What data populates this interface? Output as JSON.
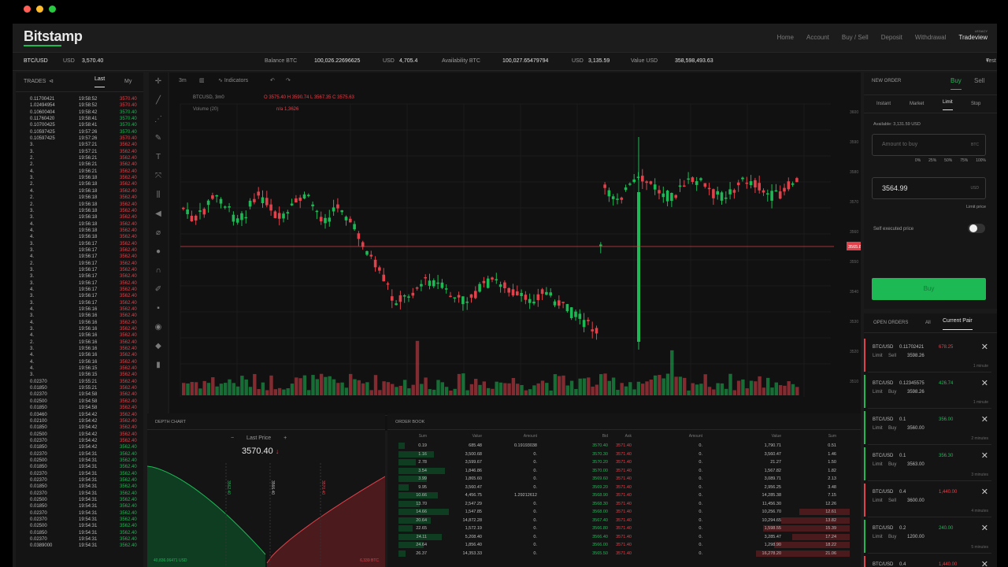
{
  "window": {
    "dot_colors": [
      "#ff5f57",
      "#febc2e",
      "#28c840"
    ]
  },
  "brand": {
    "name": "Bitstamp",
    "accent": "#1db954",
    "sell": "#e0424b"
  },
  "nav": {
    "items": [
      "Home",
      "Account",
      "Buy / Sell",
      "Deposit",
      "Withdrawal"
    ],
    "active": "Tradeview",
    "active_sup": "LEGACY"
  },
  "ticker": {
    "pair": "BTC/USD",
    "usd_label": "USD",
    "price": "3,570.40",
    "balance_label": "Balance BTC",
    "balance_btc": "100,026.22696625",
    "balance_usd_label": "USD",
    "balance_usd": "4,705.4",
    "availability_label": "Availability BTC",
    "availability_btc": "100,027.65479794",
    "avail_usd_label": "USD",
    "avail_usd": "3,135.59",
    "value_label": "Value USD",
    "value_usd": "358,598,493.63",
    "user": "Test User / Main"
  },
  "trades": {
    "title": "TRADES",
    "tabs": [
      "Last",
      "My"
    ],
    "rows": [
      {
        "amount": "0.11700421",
        "time": "19:58:52",
        "price": "3570.40",
        "side": "sell"
      },
      {
        "amount": "1.02494954",
        "time": "19:58:52",
        "price": "3570.40",
        "side": "sell"
      },
      {
        "amount": "0.10600404",
        "time": "19:58:42",
        "price": "3570.40",
        "side": "buy"
      },
      {
        "amount": "0.11760420",
        "time": "19:58:41",
        "price": "3570.40",
        "side": "buy"
      },
      {
        "amount": "0.10700425",
        "time": "19:58:41",
        "price": "3570.40",
        "side": "buy"
      },
      {
        "amount": "0.10597425",
        "time": "19:57:26",
        "price": "3570.40",
        "side": "buy"
      },
      {
        "amount": "0.10597425",
        "time": "19:57:26",
        "price": "3570.40",
        "side": "sell"
      },
      {
        "amount": "3.",
        "time": "19:57:21",
        "price": "3562.40",
        "side": "sell"
      },
      {
        "amount": "3.",
        "time": "19:57:21",
        "price": "3562.40",
        "side": "sell"
      },
      {
        "amount": "2.",
        "time": "19:56:21",
        "price": "3562.40",
        "side": "sell"
      },
      {
        "amount": "2.",
        "time": "19:56:21",
        "price": "3562.40",
        "side": "sell"
      },
      {
        "amount": "4.",
        "time": "19:56:21",
        "price": "3562.40",
        "side": "sell"
      },
      {
        "amount": "3.",
        "time": "19:56:18",
        "price": "3562.40",
        "side": "sell"
      },
      {
        "amount": "2.",
        "time": "19:56:18",
        "price": "3562.40",
        "side": "sell"
      },
      {
        "amount": "4.",
        "time": "19:56:18",
        "price": "3562.40",
        "side": "sell"
      },
      {
        "amount": "2.",
        "time": "19:56:18",
        "price": "3562.40",
        "side": "sell"
      },
      {
        "amount": "2.",
        "time": "19:56:18",
        "price": "3562.40",
        "side": "sell"
      },
      {
        "amount": "3.",
        "time": "19:56:18",
        "price": "3562.40",
        "side": "sell"
      },
      {
        "amount": "3.",
        "time": "19:56:18",
        "price": "3562.40",
        "side": "sell"
      },
      {
        "amount": "4.",
        "time": "19:56:18",
        "price": "3562.40",
        "side": "sell"
      },
      {
        "amount": "4.",
        "time": "19:56:18",
        "price": "3562.40",
        "side": "sell"
      },
      {
        "amount": "4.",
        "time": "19:56:18",
        "price": "3562.40",
        "side": "sell"
      },
      {
        "amount": "3.",
        "time": "19:56:17",
        "price": "3562.40",
        "side": "sell"
      },
      {
        "amount": "3.",
        "time": "19:56:17",
        "price": "3562.40",
        "side": "sell"
      },
      {
        "amount": "4.",
        "time": "19:56:17",
        "price": "3562.40",
        "side": "sell"
      },
      {
        "amount": "2.",
        "time": "19:56:17",
        "price": "3562.40",
        "side": "sell"
      },
      {
        "amount": "3.",
        "time": "19:56:17",
        "price": "3562.40",
        "side": "sell"
      },
      {
        "amount": "3.",
        "time": "19:56:17",
        "price": "3562.40",
        "side": "sell"
      },
      {
        "amount": "3.",
        "time": "19:56:17",
        "price": "3562.40",
        "side": "sell"
      },
      {
        "amount": "4.",
        "time": "19:56:17",
        "price": "3562.40",
        "side": "sell"
      },
      {
        "amount": "3.",
        "time": "19:56:17",
        "price": "3562.40",
        "side": "sell"
      },
      {
        "amount": "3.",
        "time": "19:56:17",
        "price": "3562.40",
        "side": "sell"
      },
      {
        "amount": "4.",
        "time": "19:56:16",
        "price": "3562.40",
        "side": "sell"
      },
      {
        "amount": "3.",
        "time": "19:56:16",
        "price": "3562.40",
        "side": "sell"
      },
      {
        "amount": "4.",
        "time": "19:56:16",
        "price": "3562.40",
        "side": "sell"
      },
      {
        "amount": "3.",
        "time": "19:56:16",
        "price": "3562.40",
        "side": "sell"
      },
      {
        "amount": "4.",
        "time": "19:56:16",
        "price": "3562.40",
        "side": "sell"
      },
      {
        "amount": "2.",
        "time": "19:56:16",
        "price": "3562.40",
        "side": "sell"
      },
      {
        "amount": "3.",
        "time": "19:56:16",
        "price": "3562.40",
        "side": "sell"
      },
      {
        "amount": "4.",
        "time": "19:56:16",
        "price": "3562.40",
        "side": "sell"
      },
      {
        "amount": "4.",
        "time": "19:56:16",
        "price": "3562.40",
        "side": "sell"
      },
      {
        "amount": "4.",
        "time": "19:56:15",
        "price": "3562.40",
        "side": "sell"
      },
      {
        "amount": "3.",
        "time": "19:56:15",
        "price": "3562.40",
        "side": "sell"
      },
      {
        "amount": "0.02370",
        "time": "19:55:21",
        "price": "3562.40",
        "side": "sell"
      },
      {
        "amount": "0.01850",
        "time": "19:55:21",
        "price": "3562.40",
        "side": "sell"
      },
      {
        "amount": "0.02370",
        "time": "19:54:58",
        "price": "3562.40",
        "side": "sell"
      },
      {
        "amount": "0.02500",
        "time": "19:54:58",
        "price": "3562.40",
        "side": "sell"
      },
      {
        "amount": "0.01850",
        "time": "19:54:58",
        "price": "3562.40",
        "side": "sell"
      },
      {
        "amount": "0.03460",
        "time": "19:54:42",
        "price": "3562.40",
        "side": "sell"
      },
      {
        "amount": "0.02100",
        "time": "19:54:42",
        "price": "3562.40",
        "side": "sell"
      },
      {
        "amount": "0.01850",
        "time": "19:54:42",
        "price": "3562.40",
        "side": "sell"
      },
      {
        "amount": "0.02500",
        "time": "19:54:42",
        "price": "3562.40",
        "side": "sell"
      },
      {
        "amount": "0.02370",
        "time": "19:54:42",
        "price": "3562.40",
        "side": "sell"
      },
      {
        "amount": "0.01850",
        "time": "19:54:42",
        "price": "3562.40",
        "side": "buy"
      },
      {
        "amount": "0.02370",
        "time": "19:54:31",
        "price": "3562.40",
        "side": "buy"
      },
      {
        "amount": "0.02500",
        "time": "19:54:31",
        "price": "3562.40",
        "side": "buy"
      },
      {
        "amount": "0.01850",
        "time": "19:54:31",
        "price": "3562.40",
        "side": "buy"
      },
      {
        "amount": "0.02370",
        "time": "19:54:31",
        "price": "3562.40",
        "side": "buy"
      },
      {
        "amount": "0.02370",
        "time": "19:54:31",
        "price": "3562.40",
        "side": "buy"
      },
      {
        "amount": "0.01850",
        "time": "19:54:31",
        "price": "3562.40",
        "side": "buy"
      },
      {
        "amount": "0.02370",
        "time": "19:54:31",
        "price": "3562.40",
        "side": "buy"
      },
      {
        "amount": "0.02500",
        "time": "19:54:31",
        "price": "3562.40",
        "side": "buy"
      },
      {
        "amount": "0.01850",
        "time": "19:54:31",
        "price": "3562.40",
        "side": "buy"
      },
      {
        "amount": "0.02370",
        "time": "19:54:31",
        "price": "3562.40",
        "side": "buy"
      },
      {
        "amount": "0.02370",
        "time": "19:54:31",
        "price": "3562.40",
        "side": "buy"
      },
      {
        "amount": "0.02500",
        "time": "19:54:31",
        "price": "3562.40",
        "side": "buy"
      },
      {
        "amount": "0.01850",
        "time": "19:54:31",
        "price": "3562.40",
        "side": "buy"
      },
      {
        "amount": "0.02370",
        "time": "19:54:31",
        "price": "3562.40",
        "side": "buy"
      },
      {
        "amount": "0.0389000",
        "time": "19:54:31",
        "price": "3562.40",
        "side": "buy"
      }
    ]
  },
  "chart": {
    "toolbar": [
      "3m",
      "Indicators"
    ],
    "symbol_label": "BTCUSD, 3m0",
    "ohlc": "O 3575.40  H 3590.74  L 3567.35  C 3575.63",
    "volume_label": "Volume (20)",
    "volume_value": "n/a  1,3626",
    "current_price": "3565.84",
    "bottom_left": [
      "1D",
      "5D",
      "1M",
      "3M",
      "6M",
      "YTD",
      "1Y",
      "5Y",
      "Goto..."
    ],
    "bottom_right": [
      "14:49:22 (UTC)",
      "%",
      "log",
      "auto"
    ],
    "y_ticks": [
      3600,
      3590,
      3580,
      3570,
      3560,
      3550,
      3540,
      3530,
      3520,
      3510
    ]
  },
  "order": {
    "title": "NEW ORDER",
    "tabs": [
      "Buy",
      "Sell"
    ],
    "types": [
      "Instant",
      "Market",
      "Limit",
      "Stop"
    ],
    "active_type": "Limit",
    "available": "Available: 3,131.59 USD",
    "amount_placeholder": "Amount to buy",
    "amount_unit": "BTC",
    "percents": [
      "0%",
      "25%",
      "50%",
      "75%",
      "100%"
    ],
    "limit_price": "3564.99",
    "limit_unit": "USD",
    "limit_label": "Limit price",
    "self_exec_label": "Self executed price",
    "buy_label": "Buy"
  },
  "open_orders": {
    "title": "OPEN ORDERS",
    "tabs": [
      "All",
      "Current Pair"
    ],
    "items": [
      {
        "pair": "BTC/USD",
        "amount": "0.11702421",
        "value": "678.25",
        "type": "Limit",
        "side": "Sell",
        "price": "3598.26",
        "ago": "1 minute",
        "side_color": "#e0424b"
      },
      {
        "pair": "BTC/USD",
        "amount": "0.12345575",
        "value": "426.74",
        "type": "Limit",
        "side": "Buy",
        "price": "3598.26",
        "ago": "1 minute",
        "side_color": "#1db954"
      },
      {
        "pair": "BTC/USD",
        "amount": "0.1",
        "value": "356.00",
        "type": "Limit",
        "side": "Buy",
        "price": "3560.00",
        "ago": "2 minutes",
        "side_color": "#1db954"
      },
      {
        "pair": "BTC/USD",
        "amount": "0.1",
        "value": "356.30",
        "type": "Limit",
        "side": "Buy",
        "price": "3563.00",
        "ago": "3 minutes",
        "side_color": "#1db954"
      },
      {
        "pair": "BTC/USD",
        "amount": "0.4",
        "value": "1,440.00",
        "type": "Limit",
        "side": "Sell",
        "price": "3600.00",
        "ago": "4 minutes",
        "side_color": "#e0424b"
      },
      {
        "pair": "BTC/USD",
        "amount": "0.2",
        "value": "240.00",
        "type": "Limit",
        "side": "Buy",
        "price": "1200.00",
        "ago": "5 minutes",
        "side_color": "#1db954"
      },
      {
        "pair": "BTC/USD",
        "amount": "0.4",
        "value": "1,440.00",
        "type": "Limit",
        "side": "Sell",
        "price": "3600.00",
        "ago": "6 minutes",
        "side_color": "#e0424b"
      }
    ]
  },
  "depth": {
    "title": "DEPTH CHART",
    "last_price_label": "Last Price",
    "last_price": "3570.40",
    "bid_tag": "3562.40",
    "mid_tag": "3566.40",
    "ask_tag": "3570.40",
    "left_footer": "40,836.06471 USD",
    "right_footer": "6,339 BTC"
  },
  "book": {
    "title": "ORDER BOOK",
    "columns": [
      "Sum",
      "Value",
      "Amount",
      "Bid",
      "Ask",
      "Amount",
      "Value",
      "Sum"
    ],
    "rows": [
      {
        "sum": "0.19",
        "value": "685.48",
        "amount": "0.19193038",
        "bid": "3570.40",
        "ask": "3571.40",
        "a_amount": "0.",
        "a_value": "1,790.71",
        "a_sum": "0.51"
      },
      {
        "sum": "1.16",
        "value": "3,500.68",
        "amount": "0.",
        "bid": "3570.30",
        "ask": "3571.40",
        "a_amount": "0.",
        "a_value": "3,560.47",
        "a_sum": "1.46"
      },
      {
        "sum": "2.78",
        "value": "3,599.67",
        "amount": "0.",
        "bid": "3570.20",
        "ask": "3571.40",
        "a_amount": "0.",
        "a_value": "21.27",
        "a_sum": "1.50"
      },
      {
        "sum": "3.54",
        "value": "1,846.86",
        "amount": "0.",
        "bid": "3570.00",
        "ask": "3571.40",
        "a_amount": "0.",
        "a_value": "1,567.82",
        "a_sum": "1.82"
      },
      {
        "sum": "3.99",
        "value": "1,865.60",
        "amount": "0.",
        "bid": "3569.60",
        "ask": "3571.40",
        "a_amount": "0.",
        "a_value": "3,089.71",
        "a_sum": "2.13"
      },
      {
        "sum": "9.95",
        "value": "3,560.47",
        "amount": "0.",
        "bid": "3569.20",
        "ask": "3571.40",
        "a_amount": "0.",
        "a_value": "2,956.25",
        "a_sum": "3.48"
      },
      {
        "sum": "10.66",
        "value": "4,456.75",
        "amount": "1.29212612",
        "bid": "3568.90",
        "ask": "3571.40",
        "a_amount": "0.",
        "a_value": "14,285.38",
        "a_sum": "7.15"
      },
      {
        "sum": "13.70",
        "value": "2,547.29",
        "amount": "0.",
        "bid": "3568.30",
        "ask": "3571.40",
        "a_amount": "0.",
        "a_value": "11,456.30",
        "a_sum": "12.26"
      },
      {
        "sum": "14.66",
        "value": "1,547.85",
        "amount": "0.",
        "bid": "3568.00",
        "ask": "3571.40",
        "a_amount": "0.",
        "a_value": "10,256.70",
        "a_sum": "12.61"
      },
      {
        "sum": "20.64",
        "value": "14,872.28",
        "amount": "0.",
        "bid": "3567.40",
        "ask": "3571.40",
        "a_amount": "0.",
        "a_value": "10,294.65",
        "a_sum": "13.82"
      },
      {
        "sum": "22.65",
        "value": "1,572.19",
        "amount": "0.",
        "bid": "3566.80",
        "ask": "3571.40",
        "a_amount": "0.",
        "a_value": "1,598.55",
        "a_sum": "15.39"
      },
      {
        "sum": "24.11",
        "value": "5,208.40",
        "amount": "0.",
        "bid": "3566.40",
        "ask": "3571.40",
        "a_amount": "0.",
        "a_value": "3,285.47",
        "a_sum": "17.24"
      },
      {
        "sum": "24.64",
        "value": "1,856.40",
        "amount": "0.",
        "bid": "3566.00",
        "ask": "3571.40",
        "a_amount": "0.",
        "a_value": "1,298.90",
        "a_sum": "18.22"
      },
      {
        "sum": "26.37",
        "value": "14,353.33",
        "amount": "0.",
        "bid": "3565.50",
        "ask": "3571.40",
        "a_amount": "0.",
        "a_value": "16,278.20",
        "a_sum": "21.06"
      }
    ]
  }
}
